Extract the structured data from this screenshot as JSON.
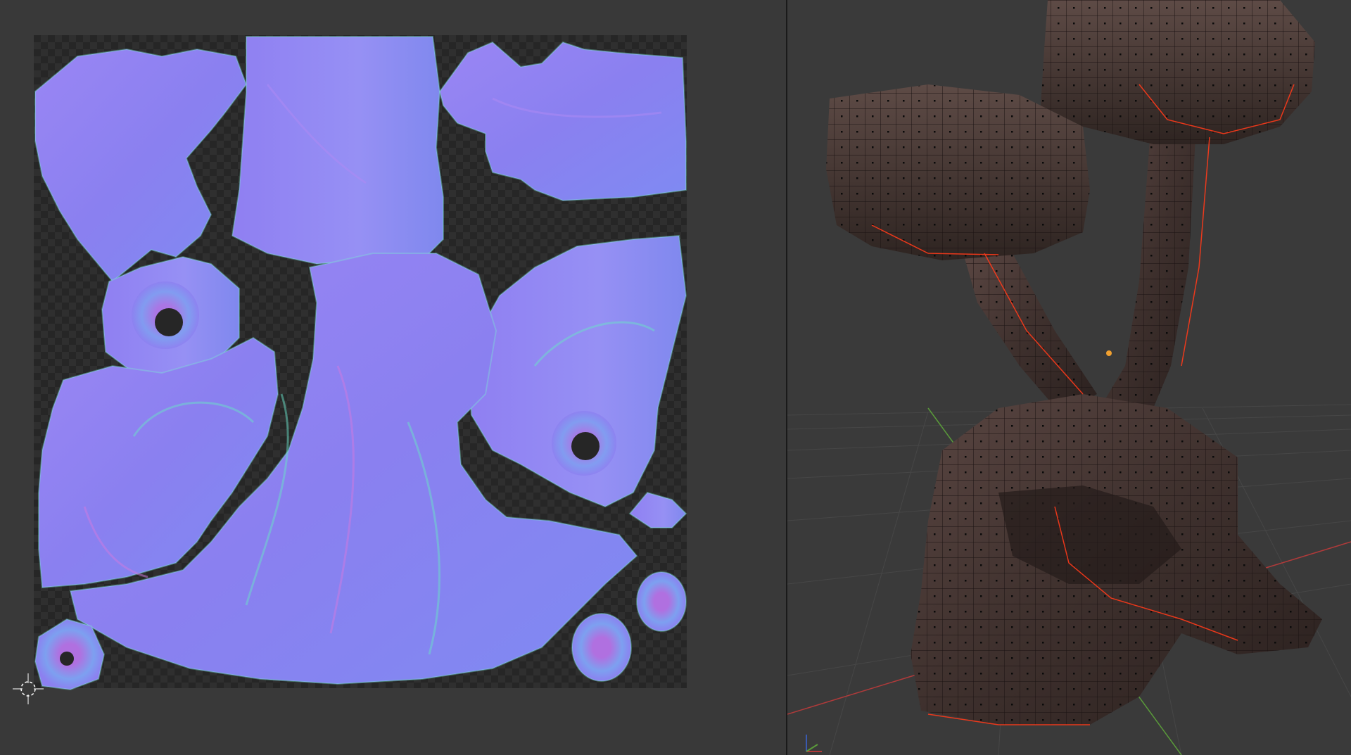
{
  "app": {
    "accent_color": "#e05a3a",
    "uv_editor": {
      "texture_type": "normal-map",
      "background_color": "#393939",
      "checker_color_a": "#2f2f2f",
      "checker_color_b": "#262626",
      "normal_base_color": "#8a7ff0",
      "show_2d_cursor": true
    },
    "viewport_3d": {
      "background_color": "#3a3a3a",
      "shading": "solid-with-wireframe",
      "mesh_color": "#4a3a36",
      "edge_color": "#1a1212",
      "seam_color": "#ff3a1a",
      "show_grid": true,
      "axis_x_color": "#b03a3a",
      "axis_y_color": "#5a9a3a",
      "axis_z_color": "#3a5ab0"
    }
  }
}
